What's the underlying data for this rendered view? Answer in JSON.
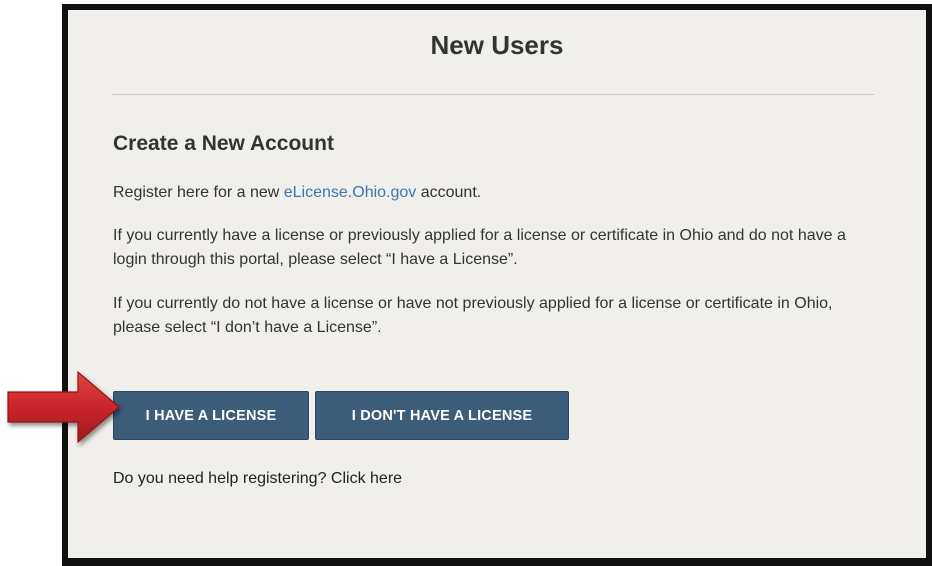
{
  "panel": {
    "title": "New Users"
  },
  "section": {
    "heading": "Create a New Account",
    "register_prefix": "Register here for a new ",
    "register_link": "eLicense.Ohio.gov",
    "register_suffix": " account.",
    "have_license_text": "If you currently have a license or previously applied for a license or certificate in Ohio and do not have a login through this portal, please select “I have a License”.",
    "no_license_text": "If you currently do not have a license or have not previously applied for a license or certificate in Ohio, please select “I don’t have a License”."
  },
  "buttons": {
    "have_license": "I HAVE A LICENSE",
    "no_license": "I DON'T HAVE A LICENSE"
  },
  "help": {
    "text": "Do you need help registering? Click here"
  },
  "colors": {
    "button_bg": "#3c5d7a",
    "link": "#3e76b0",
    "panel_bg": "#f1efec",
    "arrow": "#c8262b"
  },
  "icons": {
    "pointer_arrow": "red-arrow-icon"
  }
}
